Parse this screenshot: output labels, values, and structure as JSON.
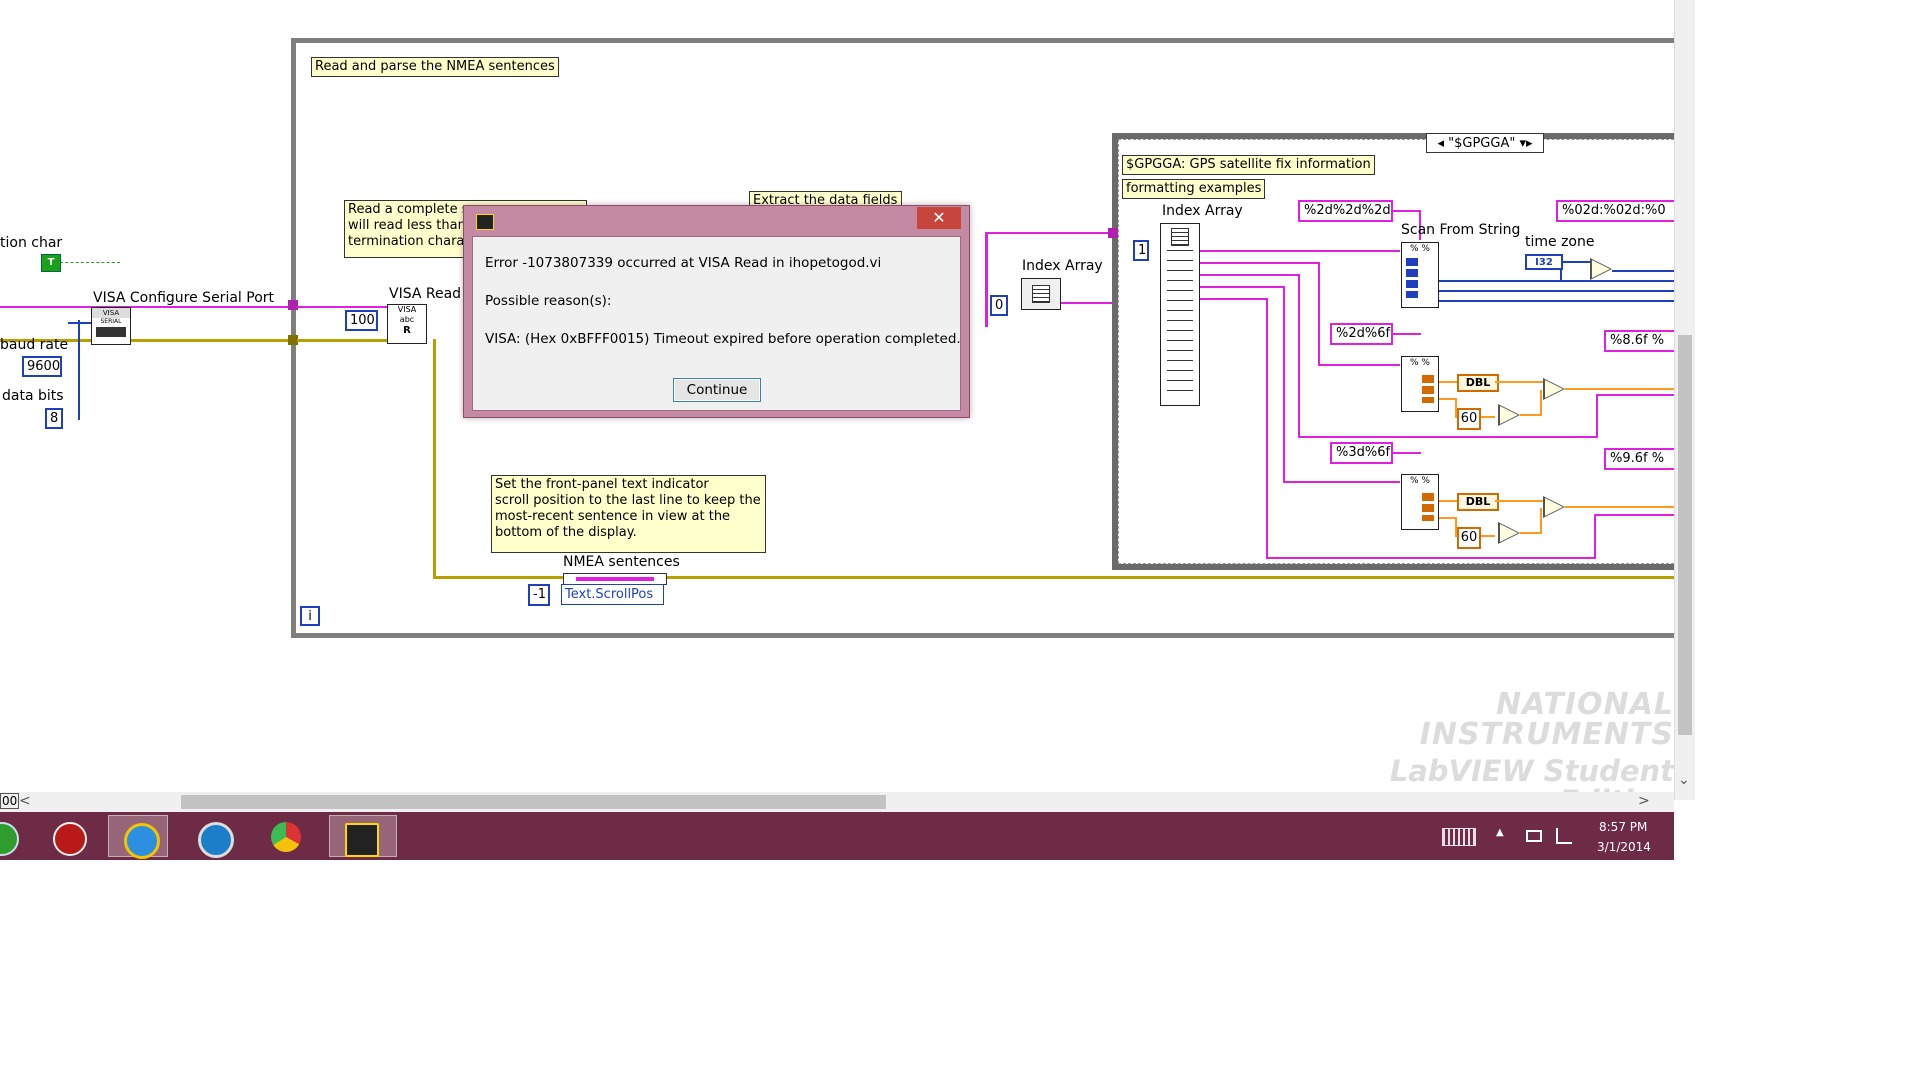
{
  "diagram": {
    "while_loop_comment": "Read and parse the NMEA sentences",
    "read_comment_lines": [
      "Read a complete s",
      "will read less than",
      "termination chara"
    ],
    "extract_comment": "Extract the data fields",
    "scroll_comment_lines": [
      "Set the front-panel text indicator",
      "scroll position to the last line to keep the",
      "most-recent sentence in view at the",
      "bottom of the display."
    ],
    "gpgga_comment": "$GPGGA: GPS satellite fix information",
    "formatting_comment": "formatting examples",
    "case_selector": "\"$GPGGA\"",
    "labels": {
      "termination_char": "tion char",
      "baud_rate": "baud rate",
      "data_bits": "data bits",
      "visa_configure": "VISA Configure Serial Port",
      "visa_read": "VISA Read",
      "index_array_outer": "Index Array",
      "index_array_inner": "Index Array",
      "scan_from_string": "Scan From String",
      "time_zone": "time zone",
      "nmea_sentences": "NMEA sentences",
      "text_scrollpos": "Text.ScrollPos"
    },
    "constants": {
      "bool_true": "T",
      "baud_value": "9600",
      "data_bits_value": "8",
      "read_count": "100",
      "index_outer": "0",
      "index_inner": "1",
      "scroll_value": "-1",
      "time_zone_type": "I32",
      "dbl_type": "DBL",
      "sixty_1": "60",
      "sixty_2": "60",
      "format_1": "%2d%2d%2d",
      "format_2": "%2d%6f",
      "format_3": "%3d%6f",
      "format_out_1": "%02d:%02d:%0",
      "format_out_2": "%8.6f %",
      "format_out_3": "%9.6f %",
      "iteration": "i"
    },
    "watermark": [
      "NATIONAL",
      "INSTRUMENTS",
      "LabVIEW Student Edition"
    ]
  },
  "dialog": {
    "error_line": "Error -1073807339 occurred at VISA Read in ihopetogod.vi",
    "possible_reasons": "Possible reason(s):",
    "reason_line": "VISA:  (Hex 0xBFFF0015) Timeout expired before operation completed.",
    "continue_label": "Continue",
    "close_glyph": "✕"
  },
  "scrollbars": {
    "h_left_text": "00",
    "left_arrow": "<",
    "right_arrow": ">",
    "down_arrow": "⌄"
  },
  "taskbar": {
    "time": "8:57 PM",
    "date": "3/1/2014",
    "up_arrow": "▲",
    "accent": "#6e2b45"
  }
}
